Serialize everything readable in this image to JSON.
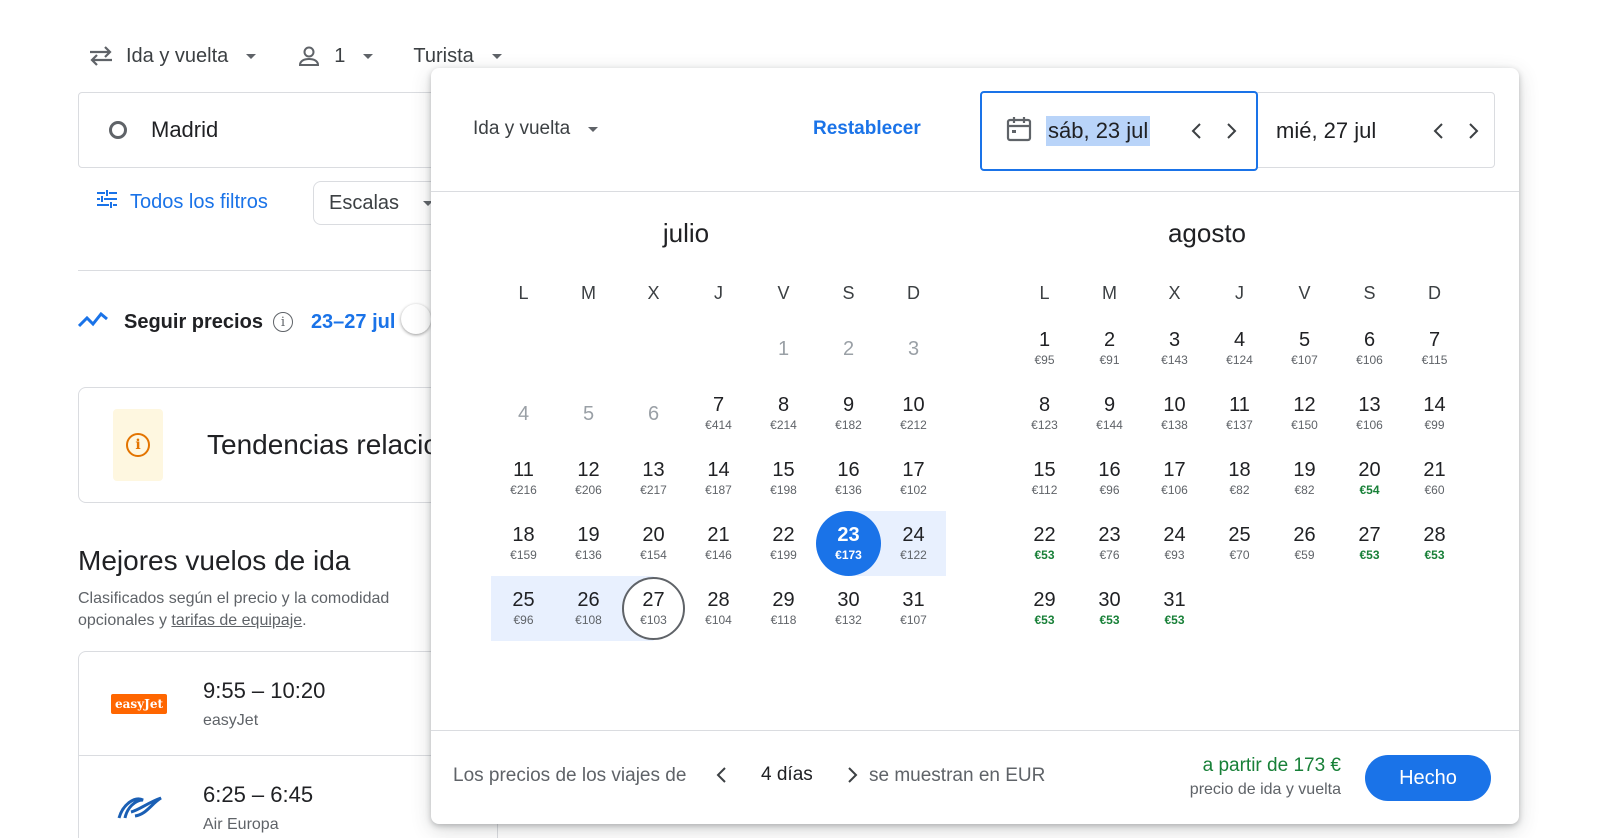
{
  "topbar": {
    "trip_type": "Ida y vuelta",
    "passengers": "1",
    "cabin": "Turista"
  },
  "search": {
    "origin": "Madrid"
  },
  "filters": {
    "all_filters": "Todos los filtros",
    "stops": "Escalas"
  },
  "tracking": {
    "label": "Seguir precios",
    "info_symbol": "i",
    "range": "23–27 jul"
  },
  "trends": {
    "title": "Tendencias relacio",
    "icon_symbol": "i"
  },
  "best_flights": {
    "title": "Mejores vuelos de ida",
    "subtitle_pre": "Clasificados según el precio y la comodidad",
    "subtitle_line2_pre": "opcionales y ",
    "subtitle_link": "tarifas de equipaje",
    "subtitle_line2_post": "."
  },
  "flights": [
    {
      "time": "9:55 – 10:20",
      "airline": "easyJet",
      "logo_text": "easyJet"
    },
    {
      "time": "6:25 – 6:45",
      "airline": "Air Europa",
      "logo_text": ""
    }
  ],
  "popup": {
    "trip_type": "Ida y vuelta",
    "reset": "Restablecer",
    "departure_date": "sáb, 23 jul",
    "return_date": "mié, 27 jul",
    "footer_prefix": "Los precios de los viajes de",
    "duration": "4 días",
    "footer_suffix": "se muestran en EUR",
    "price_from": "a partir de 173 €",
    "price_note": "precio de ida y vuelta",
    "done": "Hecho"
  },
  "colors": {
    "accent": "#1a73e8",
    "range": "#e8f0fe",
    "low_price": "#188038"
  },
  "months": [
    {
      "name": "julio",
      "weekdays": [
        "L",
        "M",
        "X",
        "J",
        "V",
        "S",
        "D"
      ],
      "offset": 4,
      "days": [
        {
          "d": "1",
          "p": "",
          "past": true
        },
        {
          "d": "2",
          "p": "",
          "past": true
        },
        {
          "d": "3",
          "p": "",
          "past": true
        },
        {
          "d": "4",
          "p": "",
          "past": true
        },
        {
          "d": "5",
          "p": "",
          "past": true
        },
        {
          "d": "6",
          "p": "",
          "past": true
        },
        {
          "d": "7",
          "p": "€414"
        },
        {
          "d": "8",
          "p": "€214"
        },
        {
          "d": "9",
          "p": "€182"
        },
        {
          "d": "10",
          "p": "€212"
        },
        {
          "d": "11",
          "p": "€216"
        },
        {
          "d": "12",
          "p": "€206"
        },
        {
          "d": "13",
          "p": "€217"
        },
        {
          "d": "14",
          "p": "€187"
        },
        {
          "d": "15",
          "p": "€198"
        },
        {
          "d": "16",
          "p": "€136"
        },
        {
          "d": "17",
          "p": "€102"
        },
        {
          "d": "18",
          "p": "€159"
        },
        {
          "d": "19",
          "p": "€136"
        },
        {
          "d": "20",
          "p": "€154"
        },
        {
          "d": "21",
          "p": "€146"
        },
        {
          "d": "22",
          "p": "€199"
        },
        {
          "d": "23",
          "p": "€173",
          "state": "selected"
        },
        {
          "d": "24",
          "p": "€122",
          "state": "range"
        },
        {
          "d": "25",
          "p": "€96",
          "state": "range"
        },
        {
          "d": "26",
          "p": "€108",
          "state": "range"
        },
        {
          "d": "27",
          "p": "€103",
          "state": "ret"
        },
        {
          "d": "28",
          "p": "€104"
        },
        {
          "d": "29",
          "p": "€118"
        },
        {
          "d": "30",
          "p": "€132"
        },
        {
          "d": "31",
          "p": "€107"
        }
      ]
    },
    {
      "name": "agosto",
      "weekdays": [
        "L",
        "M",
        "X",
        "J",
        "V",
        "S",
        "D"
      ],
      "offset": 0,
      "days": [
        {
          "d": "1",
          "p": "€95"
        },
        {
          "d": "2",
          "p": "€91"
        },
        {
          "d": "3",
          "p": "€143"
        },
        {
          "d": "4",
          "p": "€124"
        },
        {
          "d": "5",
          "p": "€107"
        },
        {
          "d": "6",
          "p": "€106"
        },
        {
          "d": "7",
          "p": "€115"
        },
        {
          "d": "8",
          "p": "€123"
        },
        {
          "d": "9",
          "p": "€144"
        },
        {
          "d": "10",
          "p": "€138"
        },
        {
          "d": "11",
          "p": "€137"
        },
        {
          "d": "12",
          "p": "€150"
        },
        {
          "d": "13",
          "p": "€106"
        },
        {
          "d": "14",
          "p": "€99"
        },
        {
          "d": "15",
          "p": "€112"
        },
        {
          "d": "16",
          "p": "€96"
        },
        {
          "d": "17",
          "p": "€106"
        },
        {
          "d": "18",
          "p": "€82"
        },
        {
          "d": "19",
          "p": "€82"
        },
        {
          "d": "20",
          "p": "€54",
          "low": true
        },
        {
          "d": "21",
          "p": "€60"
        },
        {
          "d": "22",
          "p": "€53",
          "low": true
        },
        {
          "d": "23",
          "p": "€76"
        },
        {
          "d": "24",
          "p": "€93"
        },
        {
          "d": "25",
          "p": "€70"
        },
        {
          "d": "26",
          "p": "€59"
        },
        {
          "d": "27",
          "p": "€53",
          "low": true
        },
        {
          "d": "28",
          "p": "€53",
          "low": true
        },
        {
          "d": "29",
          "p": "€53",
          "low": true
        },
        {
          "d": "30",
          "p": "€53",
          "low": true
        },
        {
          "d": "31",
          "p": "€53",
          "low": true
        }
      ]
    }
  ]
}
